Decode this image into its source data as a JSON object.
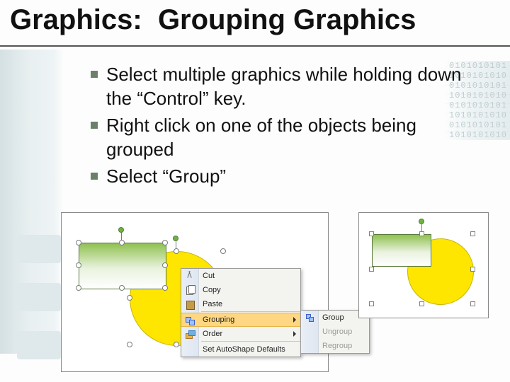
{
  "title": "Graphics:  Grouping Graphics",
  "bullets": [
    "Select multiple graphics while holding down the “Control” key.",
    "Right click on one of the objects being grouped",
    "Select “Group”"
  ],
  "binary_deco": "0101010101\n1010101010\n0101010101\n1010101010\n0101010101\n1010101010\n0101010101\n1010101010",
  "context_menu": {
    "items": [
      {
        "label": "Cut",
        "icon": "cut-icon"
      },
      {
        "label": "Copy",
        "icon": "copy-icon"
      },
      {
        "label": "Paste",
        "icon": "paste-icon"
      }
    ],
    "items2": [
      {
        "label": "Grouping",
        "icon": "grouping-icon",
        "submenu": true,
        "hover": true
      },
      {
        "label": "Order",
        "icon": "order-icon",
        "submenu": true
      }
    ],
    "items3": [
      {
        "label": "Set AutoShape Defaults"
      }
    ]
  },
  "submenu": {
    "items": [
      {
        "label": "Group",
        "icon": "group-icon",
        "enabled": true
      },
      {
        "label": "Ungroup",
        "enabled": false
      },
      {
        "label": "Regroup",
        "enabled": false
      }
    ]
  }
}
